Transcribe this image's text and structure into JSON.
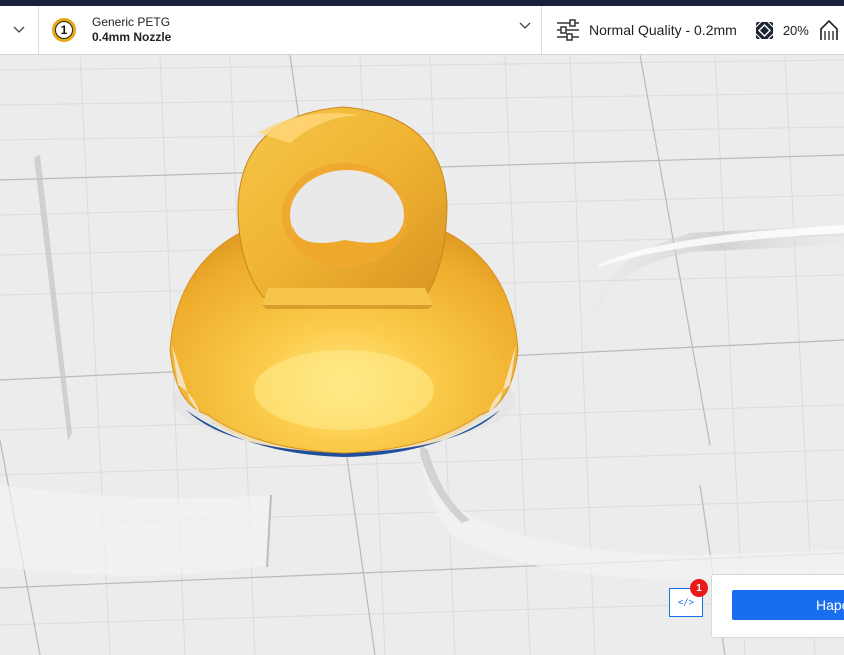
{
  "toolbar": {
    "material": "Generic PETG",
    "nozzle": "0.4mm Nozzle",
    "extruder_number": "1",
    "quality": "Normal Quality - 0.2mm",
    "infill": "20%",
    "icons": [
      "chevron-down-icon",
      "extruder-icon",
      "settings-sliders-icon",
      "infill-icon",
      "support-icon"
    ]
  },
  "notifications": {
    "count": "1",
    "log_icon": "</>"
  },
  "slice_button": {
    "label": "Hape"
  },
  "colors": {
    "brand_blue": "#196ef0",
    "model_yellow": "#f4b331",
    "extruder_color": "#e6a817",
    "badge_red": "#e81b1b"
  }
}
